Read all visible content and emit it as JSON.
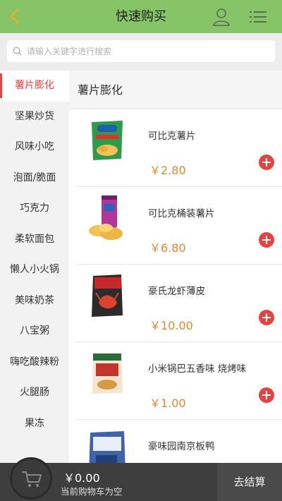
{
  "header": {
    "title": "快速购买"
  },
  "search": {
    "placeholder": "请输入关键字进行搜索"
  },
  "sidebar": {
    "items": [
      {
        "label": "薯片膨化",
        "active": true
      },
      {
        "label": "坚果炒货"
      },
      {
        "label": "风味小吃"
      },
      {
        "label": "泡面/脆面"
      },
      {
        "label": "巧克力"
      },
      {
        "label": "柔软面包"
      },
      {
        "label": "懒人小火锅"
      },
      {
        "label": "美味奶茶"
      },
      {
        "label": "八宝粥"
      },
      {
        "label": "嗨吃酸辣粉"
      },
      {
        "label": "火腿肠"
      },
      {
        "label": "果冻"
      }
    ]
  },
  "main": {
    "section_title": "薯片膨化",
    "products": [
      {
        "name": "可比克薯片",
        "price": "￥2.80"
      },
      {
        "name": "可比克桶装薯片",
        "price": "￥6.80"
      },
      {
        "name": "豪氏龙虾薄皮",
        "price": "￥10.00"
      },
      {
        "name": "小米锅巴五香味 烧烤味",
        "price": "￥1.00"
      },
      {
        "name": "豪味园南京板鸭",
        "price": ""
      }
    ]
  },
  "cart": {
    "total": "￥0.00",
    "status": "当前购物车为空",
    "checkout_label": "去结算"
  },
  "colors": {
    "header_bg": "#86c467",
    "accent_red": "#e64340",
    "price_orange": "#e4872d",
    "cartbar_bg": "#3e3e3e"
  }
}
